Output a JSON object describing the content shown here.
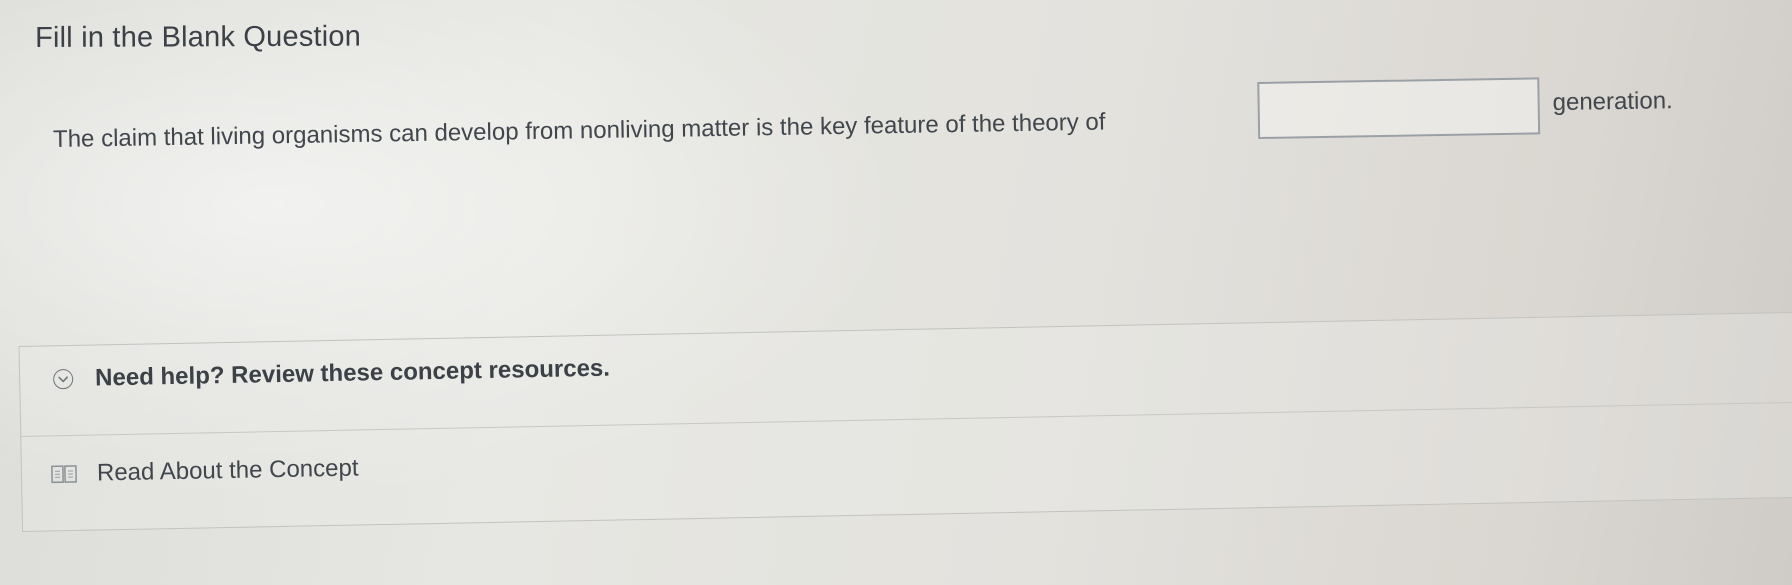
{
  "header": {
    "title": "Fill in the Blank Question"
  },
  "question": {
    "text_before": "The claim that living organisms can develop from nonliving matter is the key feature of the theory of",
    "answer_value": "",
    "text_after": "generation."
  },
  "resources": {
    "help_label": "Need help? Review these concept resources.",
    "help_icon": "chevron-down-circle-icon",
    "items": [
      {
        "label": "Read About the Concept",
        "icon": "book-icon"
      }
    ]
  },
  "colors": {
    "text": "#3b4147",
    "border": "#c2c3bf",
    "blank_border": "#9aa0a6"
  }
}
